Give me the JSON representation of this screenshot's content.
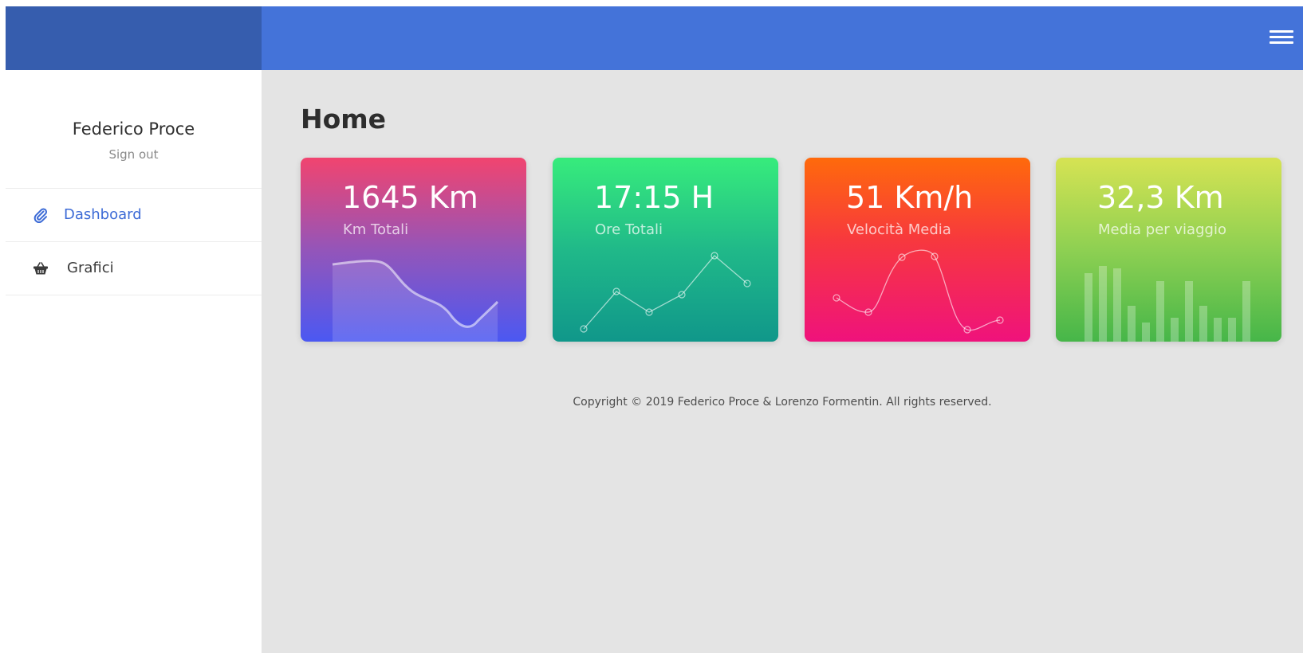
{
  "header": {
    "menu_icon": "hamburger-icon",
    "colors": {
      "left": "#365dae",
      "right": "#4473d9"
    }
  },
  "sidebar": {
    "user_name": "Federico Proce",
    "sign_out": "Sign out",
    "items": [
      {
        "label": "Dashboard",
        "icon": "paperclip-icon",
        "active": true,
        "color": "#3d6bd6"
      },
      {
        "label": "Grafici",
        "icon": "basket-icon",
        "active": false
      }
    ]
  },
  "main": {
    "title": "Home",
    "cards": [
      {
        "value": "1645 Km",
        "label": "Km Totali",
        "chart": "area"
      },
      {
        "value": "17:15 H",
        "label": "Ore Totali",
        "chart": "line"
      },
      {
        "value": "51 Km/h",
        "label": "Velocità Media",
        "chart": "curve"
      },
      {
        "value": "32,3 Km",
        "label": "Media per viaggio",
        "chart": "bar"
      }
    ],
    "footer": "Copyright © 2019 Federico Proce & Lorenzo Formentin. All rights reserved."
  }
}
